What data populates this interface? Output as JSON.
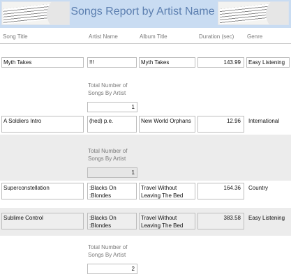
{
  "report": {
    "title": "Songs Report by Artist Name"
  },
  "columns": {
    "song": "Song Title",
    "artist": "Artist Name",
    "album": "Album Title",
    "duration": "Duration (sec)",
    "genre": "Genre"
  },
  "rows": [
    {
      "song": "Myth Takes",
      "artist": "!!!",
      "album": "Myth Takes",
      "duration": "143.99",
      "genre": "Easy Listening"
    },
    {
      "song": "A Soldiers Intro",
      "artist": "(hed) p.e.",
      "album": "New World Orphans",
      "duration": "12.96",
      "genre": "International"
    },
    {
      "song": "Superconstellation",
      "artist": ":Blacks On :Blondes",
      "album": "Travel Without Leaving The Bed",
      "duration": "164.36",
      "genre": "Country"
    },
    {
      "song": "Sublime Control",
      "artist": ":Blacks On :Blondes",
      "album": "Travel Without Leaving The Bed",
      "duration": "383.58",
      "genre": "Easy Listening"
    }
  ],
  "totals": [
    {
      "label": "Total Number of Songs By Artist",
      "value": "1"
    },
    {
      "label": "Total Number of Songs By Artist",
      "value": "1"
    },
    {
      "label": "Total Number of Songs By Artist",
      "value": "2"
    }
  ],
  "icons": {
    "header_left": "sheet-music-image",
    "header_right": "sheet-music-image"
  },
  "colors": {
    "header_bg": "#c9dcf2",
    "title": "#5c7fb0",
    "alt_band": "#ececec"
  }
}
